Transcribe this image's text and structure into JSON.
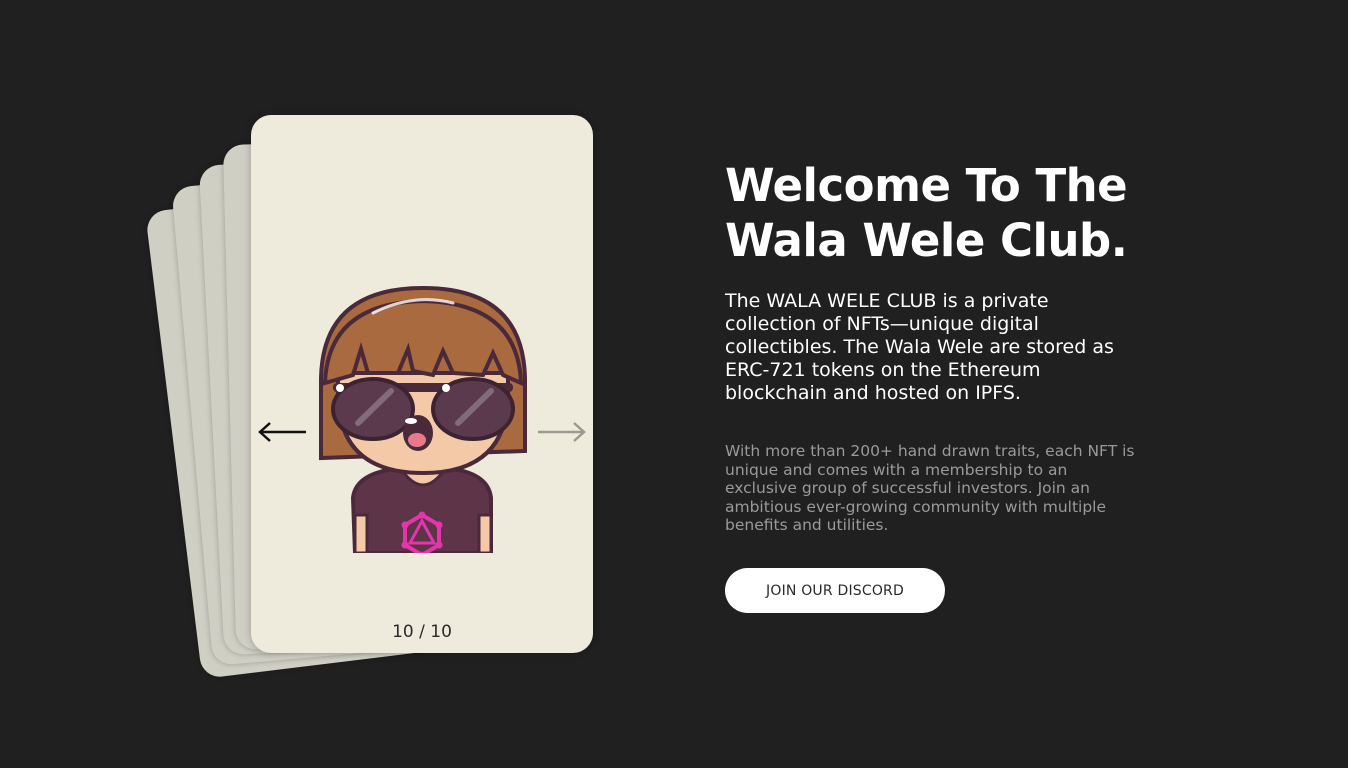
{
  "carousel": {
    "counter": "10 / 10",
    "prev_icon": "arrow-left-icon",
    "next_icon": "arrow-right-icon",
    "avatar_icon": "nft-avatar"
  },
  "hero": {
    "title": "Welcome To The Wala Wele Club.",
    "lead": "The WALA WELE CLUB is a private collection of NFTs—unique digital collectibles. The Wala Wele are stored as ERC-721 tokens on the Ethereum blockchain and hosted on IPFS.",
    "sub": "With more than 200+ hand drawn traits, each NFT is unique and comes with a membership to an exclusive group of successful investors. Join an ambitious ever-growing community with multiple benefits and utilities.",
    "cta_label": "JOIN OUR DISCORD"
  },
  "colors": {
    "background": "#202020",
    "card": "#eeebdd",
    "card_back": "#cfcfc4",
    "text_primary": "#ffffff",
    "text_secondary": "#9a9a9a"
  }
}
